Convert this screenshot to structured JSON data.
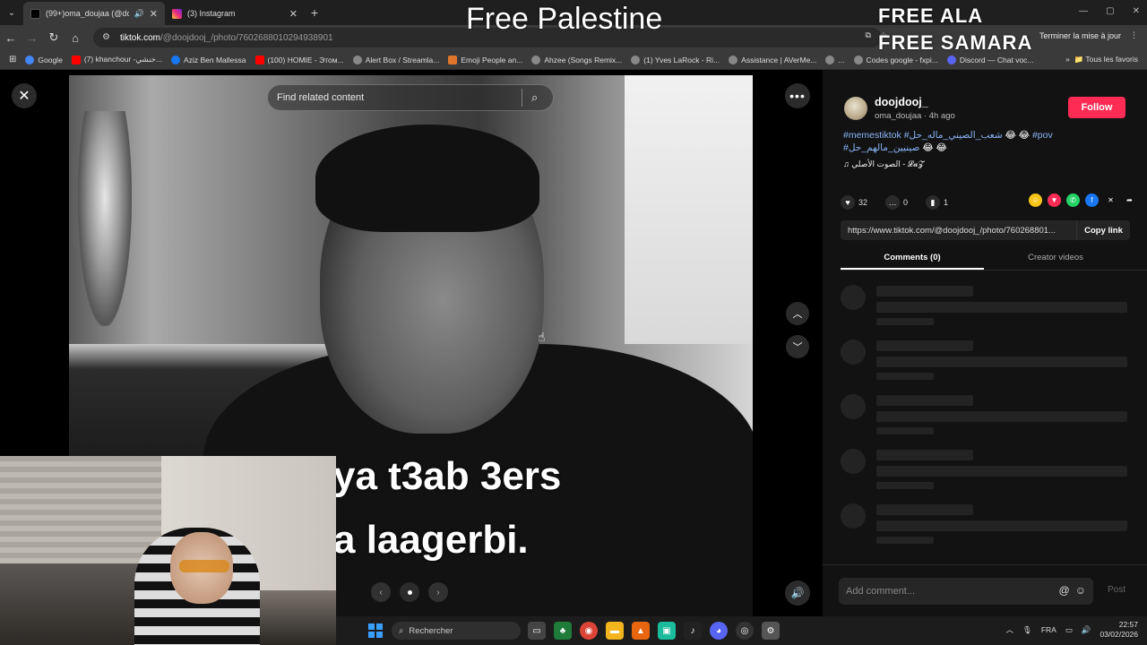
{
  "browser": {
    "tabs": [
      {
        "title": "(99+)oma_doujaa (@doojd…",
        "active": true
      },
      {
        "title": "(3) Instagram",
        "active": false
      }
    ],
    "url_host": "tiktok.com",
    "url_path": "/@doojdooj_/photo/7602688010294938901",
    "update_label": "Terminer la mise à jour",
    "bookmarks": [
      "Google",
      "(7) khanchour -خنشي...",
      "Aziz Ben Mallessa",
      "(100) HOMIE - Этом...",
      "Alert Box / Streamla...",
      "Emoji People an...",
      "Ahzee (Songs Remix...",
      "(1) Yves LaRock - Ri...",
      "Assistance | AVerMe...",
      "...",
      "Codes google - fxpi...",
      "Discord — Chat voc..."
    ],
    "all_bookmarks": "Tous les favoris"
  },
  "overlay": {
    "line1": "Free Palestine",
    "line2": "FREE ALA",
    "line3": "FREE SAMARA"
  },
  "viewer": {
    "search_placeholder": "Find related content",
    "caption_line1": "ya t3ab 3ers",
    "caption_line2": "a laagerbi."
  },
  "post": {
    "username": "doojdooj_",
    "subname": "oma_doujaa · 4h ago",
    "follow_label": "Follow",
    "hashtag1": "#memestiktok",
    "hashtag2": "#شعب_الصيني_ماله_حل",
    "emoji1": "😂 😂",
    "hashtag3": "#pov",
    "hashtag4": "#صينيين_مالهم_حل",
    "emoji2": "😂 😂",
    "sound": "♫ الصوت الأصلي - 𝓛𝓪𝓩",
    "likes": "32",
    "comments": "0",
    "saves": "1",
    "link": "https://www.tiktok.com/@doojdooj_/photo/760268801...",
    "copy_label": "Copy link",
    "tab_comments": "Comments (0)",
    "tab_creator": "Creator videos",
    "comment_placeholder": "Add comment...",
    "post_label": "Post"
  },
  "taskbar": {
    "search_placeholder": "Rechercher",
    "lang": "FRA",
    "time": "22:57",
    "date": "03/02/2026"
  },
  "colors": {
    "accent": "#fe2c55",
    "hashtag": "#8ab4f8"
  }
}
